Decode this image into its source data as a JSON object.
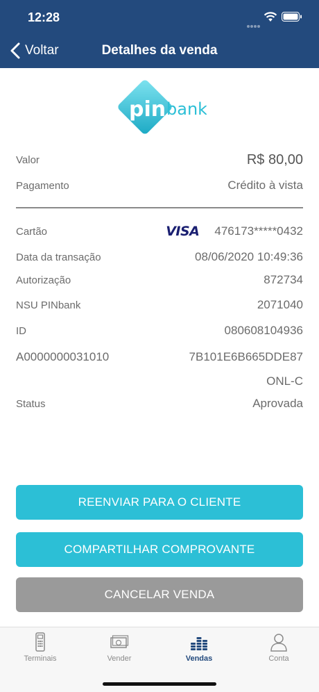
{
  "status_bar": {
    "time": "12:28"
  },
  "nav": {
    "back_label": "Voltar",
    "title": "Detalhes da venda"
  },
  "logo": {
    "text_pin": "pin",
    "text_bank": "bank",
    "accent_color": "#2cbfd6"
  },
  "summary": {
    "valor_label": "Valor",
    "valor_value": "R$ 80,00",
    "pagamento_label": "Pagamento",
    "pagamento_value": "Crédito à vista"
  },
  "details": {
    "cartao_label": "Cartão",
    "card_brand": "VISA",
    "card_number": "476173*****0432",
    "data_label": "Data da transação",
    "data_value": "08/06/2020 10:49:36",
    "autorizacao_label": "Autorização",
    "autorizacao_value": "872734",
    "nsu_label": "NSU PINbank",
    "nsu_value": "2071040",
    "id_label": "ID",
    "id_value": "080608104936",
    "aid_label": "A0000000031010",
    "aid_value": "7B101E6B665DDE87",
    "onl_value": "ONL-C",
    "status_label": "Status",
    "status_value": "Aprovada"
  },
  "buttons": {
    "resend": "REENVIAR PARA O CLIENTE",
    "share": "COMPARTILHAR COMPROVANTE",
    "cancel": "CANCELAR VENDA"
  },
  "tabbar": {
    "items": [
      {
        "label": "Terminais",
        "icon": "terminal-icon"
      },
      {
        "label": "Vender",
        "icon": "cash-icon"
      },
      {
        "label": "Vendas",
        "icon": "coins-icon"
      },
      {
        "label": "Conta",
        "icon": "user-icon"
      }
    ],
    "active": "Vendas"
  },
  "colors": {
    "header": "#234a7d",
    "primary_button": "#2cbfd6",
    "cancel_button": "#9a9a9a",
    "visa": "#1a1f71"
  }
}
